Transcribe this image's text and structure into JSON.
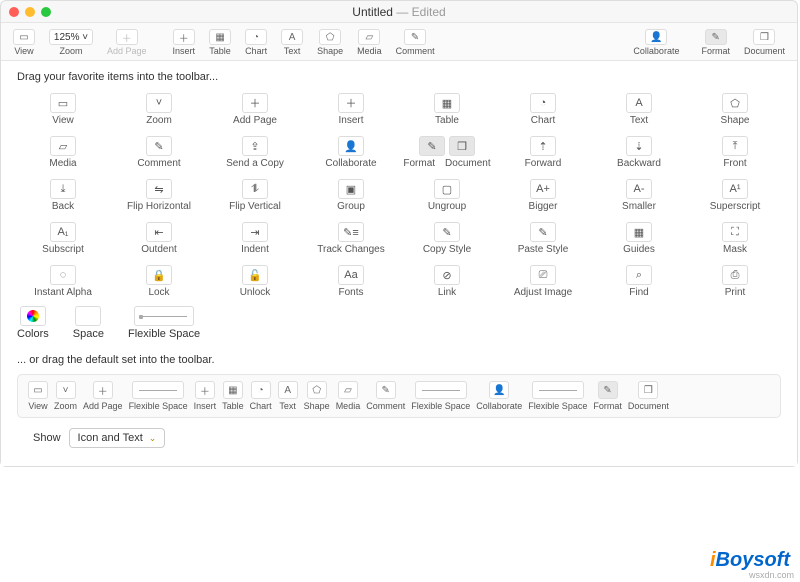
{
  "title": {
    "name": "Untitled",
    "status": "Edited"
  },
  "toolbar": {
    "zoom_value": "125%",
    "items": [
      {
        "label": "View"
      },
      {
        "label": "Zoom"
      },
      {
        "label": "Add Page"
      },
      {
        "label": "Insert"
      },
      {
        "label": "Table"
      },
      {
        "label": "Chart"
      },
      {
        "label": "Text"
      },
      {
        "label": "Shape"
      },
      {
        "label": "Media"
      },
      {
        "label": "Comment"
      },
      {
        "label": "Collaborate"
      },
      {
        "label": "Format"
      },
      {
        "label": "Document"
      }
    ]
  },
  "instructions": {
    "drag": "Drag your favorite items into the toolbar...",
    "default": "... or drag the default set into the toolbar."
  },
  "palette": [
    {
      "id": "view",
      "label": "View",
      "glyph": "▭"
    },
    {
      "id": "zoom",
      "label": "Zoom",
      "glyph": "˅"
    },
    {
      "id": "add-page",
      "label": "Add Page",
      "glyph": "＋"
    },
    {
      "id": "insert",
      "label": "Insert",
      "glyph": "＋"
    },
    {
      "id": "table",
      "label": "Table",
      "glyph": "▦"
    },
    {
      "id": "chart",
      "label": "Chart",
      "glyph": "◔"
    },
    {
      "id": "text",
      "label": "Text",
      "glyph": "A"
    },
    {
      "id": "shape",
      "label": "Shape",
      "glyph": "⬠"
    },
    {
      "id": "media",
      "label": "Media",
      "glyph": "▱"
    },
    {
      "id": "comment",
      "label": "Comment",
      "glyph": "✎"
    },
    {
      "id": "send-copy",
      "label": "Send a Copy",
      "glyph": "⇪"
    },
    {
      "id": "collaborate",
      "label": "Collaborate",
      "glyph": "👤"
    },
    {
      "id": "format",
      "label": "Format",
      "glyph": "✎",
      "selected": true,
      "double": true,
      "second_id": "document",
      "second_label": "Document",
      "second_glyph": "❒"
    },
    {
      "id": "forward",
      "label": "Forward",
      "glyph": "⇡"
    },
    {
      "id": "backward",
      "label": "Backward",
      "glyph": "⇣"
    },
    {
      "id": "front",
      "label": "Front",
      "glyph": "⤒"
    },
    {
      "id": "back",
      "label": "Back",
      "glyph": "⤓"
    },
    {
      "id": "flip-horizontal",
      "label": "Flip Horizontal",
      "glyph": "⇋"
    },
    {
      "id": "flip-vertical",
      "label": "Flip Vertical",
      "glyph": "⥮"
    },
    {
      "id": "group",
      "label": "Group",
      "glyph": "▣"
    },
    {
      "id": "ungroup",
      "label": "Ungroup",
      "glyph": "▢"
    },
    {
      "id": "bigger",
      "label": "Bigger",
      "glyph": "A+"
    },
    {
      "id": "smaller",
      "label": "Smaller",
      "glyph": "A-"
    },
    {
      "id": "superscript",
      "label": "Superscript",
      "glyph": "A¹"
    },
    {
      "id": "subscript",
      "label": "Subscript",
      "glyph": "A₁"
    },
    {
      "id": "outdent",
      "label": "Outdent",
      "glyph": "⇤"
    },
    {
      "id": "indent",
      "label": "Indent",
      "glyph": "⇥"
    },
    {
      "id": "track-changes",
      "label": "Track Changes",
      "glyph": "✎≡"
    },
    {
      "id": "copy-style",
      "label": "Copy Style",
      "glyph": "✎"
    },
    {
      "id": "paste-style",
      "label": "Paste Style",
      "glyph": "✎"
    },
    {
      "id": "guides",
      "label": "Guides",
      "glyph": "▦"
    },
    {
      "id": "mask",
      "label": "Mask",
      "glyph": "⛶"
    },
    {
      "id": "instant-alpha",
      "label": "Instant Alpha",
      "glyph": "◌"
    },
    {
      "id": "lock",
      "label": "Lock",
      "glyph": "🔒"
    },
    {
      "id": "unlock",
      "label": "Unlock",
      "glyph": "🔓"
    },
    {
      "id": "fonts",
      "label": "Fonts",
      "glyph": "Aa"
    },
    {
      "id": "link",
      "label": "Link",
      "glyph": "⊘"
    },
    {
      "id": "adjust-image",
      "label": "Adjust Image",
      "glyph": "⎚"
    },
    {
      "id": "find",
      "label": "Find",
      "glyph": "⌕"
    },
    {
      "id": "print",
      "label": "Print",
      "glyph": "⎙"
    }
  ],
  "extras": [
    {
      "id": "colors",
      "label": "Colors",
      "glyph": "◯"
    },
    {
      "id": "space",
      "label": "Space",
      "glyph": ""
    },
    {
      "id": "flexible-space",
      "label": "Flexible Space",
      "glyph": "↔"
    }
  ],
  "default_set": [
    {
      "id": "view",
      "label": "View",
      "glyph": "▭"
    },
    {
      "id": "zoom",
      "label": "Zoom",
      "glyph": "˅"
    },
    {
      "id": "add-page",
      "label": "Add Page",
      "glyph": "＋"
    },
    {
      "id": "flex1",
      "label": "Flexible Space",
      "flex": true
    },
    {
      "id": "insert",
      "label": "Insert",
      "glyph": "＋"
    },
    {
      "id": "table",
      "label": "Table",
      "glyph": "▦"
    },
    {
      "id": "chart",
      "label": "Chart",
      "glyph": "◔"
    },
    {
      "id": "text",
      "label": "Text",
      "glyph": "A"
    },
    {
      "id": "shape",
      "label": "Shape",
      "glyph": "⬠"
    },
    {
      "id": "media",
      "label": "Media",
      "glyph": "▱"
    },
    {
      "id": "comment",
      "label": "Comment",
      "glyph": "✎"
    },
    {
      "id": "flex2",
      "label": "Flexible Space",
      "flex": true
    },
    {
      "id": "collaborate",
      "label": "Collaborate",
      "glyph": "👤"
    },
    {
      "id": "flex3",
      "label": "Flexible Space",
      "flex": true
    },
    {
      "id": "format",
      "label": "Format",
      "glyph": "✎",
      "selected": true
    },
    {
      "id": "document",
      "label": "Document",
      "glyph": "❒"
    }
  ],
  "footer": {
    "show_label": "Show",
    "show_value": "Icon and Text"
  },
  "watermark": "iBoysoft",
  "source": "wsxdn.com"
}
